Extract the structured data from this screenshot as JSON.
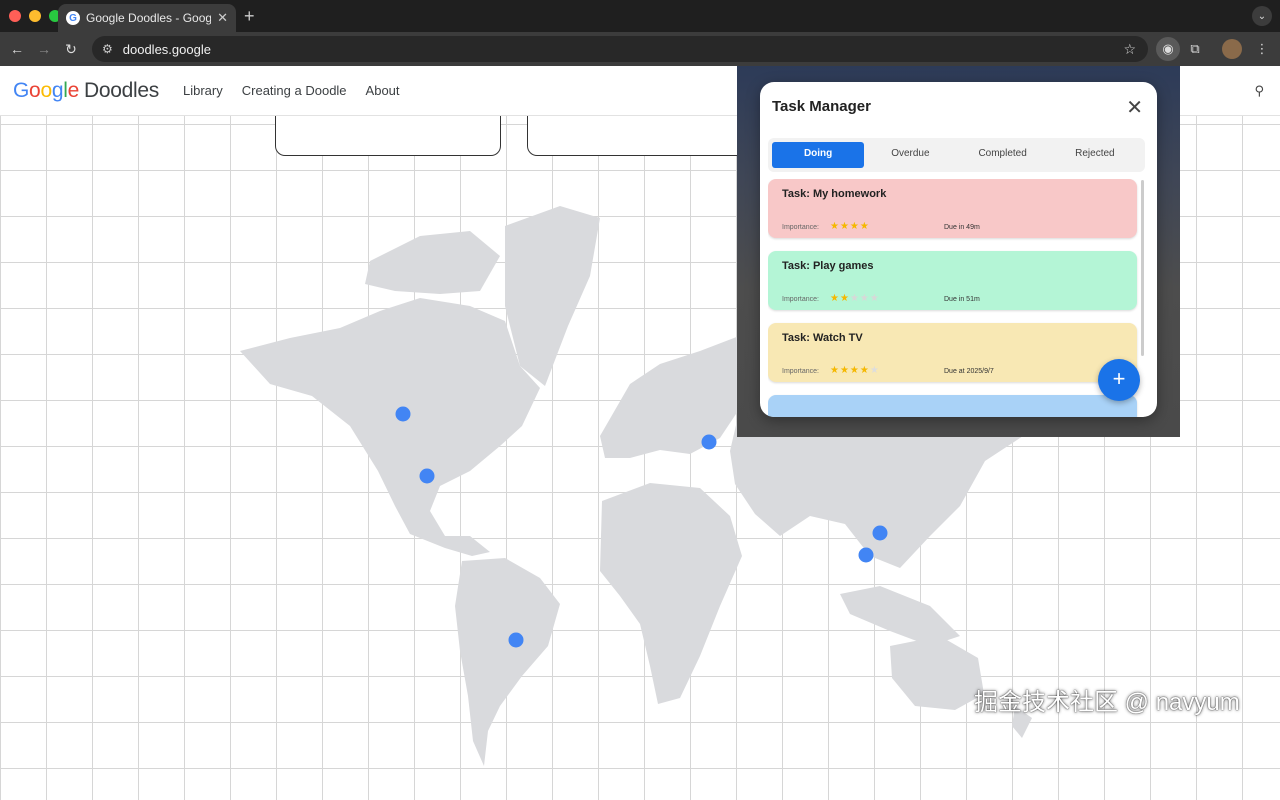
{
  "browser": {
    "tab_title": "Google Doodles - Google's S…",
    "tab_favicon": "G",
    "url": "doodles.google",
    "site_info_icon": "⚙",
    "new_tab": "+",
    "close_tab": "✕"
  },
  "site": {
    "logo_google": [
      "G",
      "o",
      "o",
      "g",
      "l",
      "e"
    ],
    "logo_doodles": "Doodles",
    "nav": [
      "Library",
      "Creating a Doodle",
      "About"
    ]
  },
  "task_manager": {
    "title": "Task Manager",
    "close": "✕",
    "tabs": [
      "Doing",
      "Overdue",
      "Completed",
      "Rejected"
    ],
    "active_tab": "Doing",
    "importance_label": "Importance:",
    "tasks": [
      {
        "name": "Task: My homework",
        "stars": "★★★★",
        "rating": 4,
        "due": "Due in 49m",
        "color": "#f8c8c8"
      },
      {
        "name": "Task: Play games",
        "stars": "★★",
        "rating": 2,
        "due": "Due in 51m",
        "color": "#b4f5d6"
      },
      {
        "name": "Task: Watch TV",
        "stars": "★★★★",
        "rating": 4,
        "due": "Due at 2025/9/7",
        "color": "#f8e8b4"
      }
    ],
    "fab": "+"
  },
  "watermark": "掘金技术社区 @ navyum",
  "colors": {
    "accent": "#1a73e8",
    "star": "#f5b800",
    "marker": "#4285f4"
  }
}
